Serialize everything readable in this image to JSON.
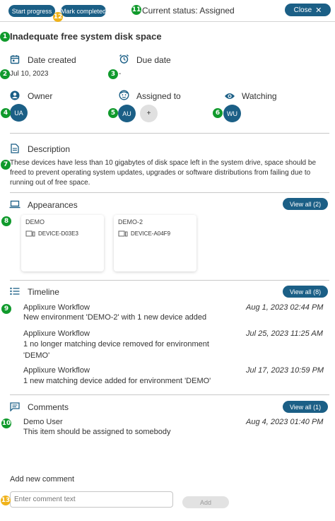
{
  "toolbar": {
    "start_progress": "Start progress",
    "mark_completed": "Mark completed",
    "current_status": "Current status: Assigned",
    "close": "Close"
  },
  "issue": {
    "title": "Inadequate free system disk space"
  },
  "dates": {
    "created_label": "Date created",
    "created_value": "Jul 10, 2023",
    "due_label": "Due date",
    "due_value": "-"
  },
  "people": {
    "owner_label": "Owner",
    "owner_initials": "UA",
    "assigned_label": "Assigned to",
    "assigned_initials": "AU",
    "add_symbol": "+",
    "watching_label": "Watching",
    "watching_initials": "WU"
  },
  "description": {
    "label": "Description",
    "text": "These devices have less than 10 gigabytes of disk space left in the system drive, space should be freed to prevent operating system updates, upgrades or software distributions from failing due to running out of free space."
  },
  "appearances": {
    "label": "Appearances",
    "view_all": "View all (2)",
    "cards": [
      {
        "environment": "DEMO",
        "device": "DEVICE-D03E3"
      },
      {
        "environment": "DEMO-2",
        "device": "DEVICE-A04F9"
      }
    ]
  },
  "timeline": {
    "label": "Timeline",
    "view_all": "View all (8)",
    "entries": [
      {
        "author": "Applixure Workflow",
        "date": "Aug 1, 2023 02:44 PM",
        "text": "New environment 'DEMO-2' with 1 new device added"
      },
      {
        "author": "Applixure Workflow",
        "date": "Jul 25, 2023 11:25 AM",
        "text": "1 no longer matching device removed for environment 'DEMO'"
      },
      {
        "author": "Applixure Workflow",
        "date": "Jul 17, 2023 10:59 PM",
        "text": "1 new matching device added for environment 'DEMO'"
      }
    ]
  },
  "comments": {
    "label": "Comments",
    "view_all": "View all (1)",
    "entries": [
      {
        "author": "Demo User",
        "date": "Aug 4, 2023 01:40 PM",
        "text": "This item should be assigned to somebody"
      }
    ],
    "add_label": "Add new comment",
    "placeholder": "Enter comment text",
    "add_button": "Add"
  },
  "markers": [
    "1",
    "2",
    "3",
    "4",
    "5",
    "6",
    "7",
    "8",
    "9",
    "10",
    "11",
    "12",
    "13"
  ],
  "colors": {
    "primary": "#1b5f86",
    "marker_green": "#109a2c",
    "marker_orange": "#f0b21a"
  }
}
